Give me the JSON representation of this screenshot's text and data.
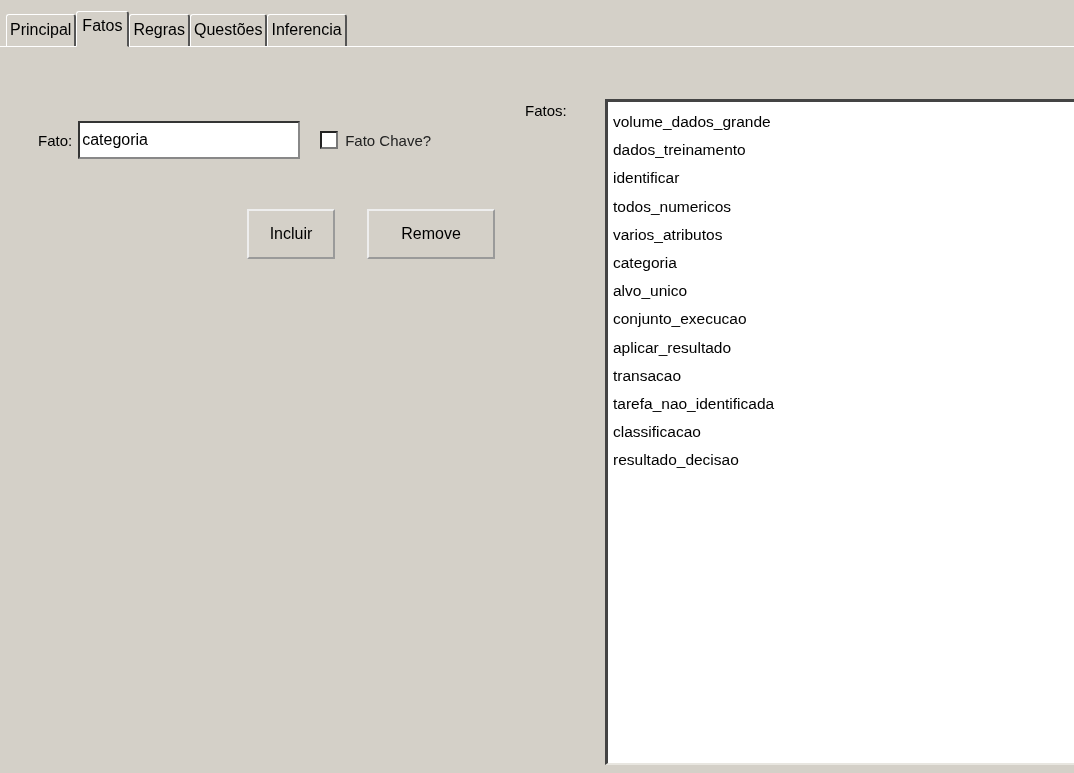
{
  "tabs": [
    {
      "label": "Principal",
      "selected": false
    },
    {
      "label": "Fatos",
      "selected": true
    },
    {
      "label": "Regras",
      "selected": false
    },
    {
      "label": "Questões",
      "selected": false
    },
    {
      "label": "Inferencia",
      "selected": false
    }
  ],
  "fact_field": {
    "label": "Fato:",
    "value": "categoria"
  },
  "key_fact": {
    "label": "Fato Chave?",
    "checked": false
  },
  "buttons": [
    "Incluir",
    "Remove"
  ],
  "facts_list": {
    "label": "Fatos:",
    "items": [
      "volume_dados_grande",
      "dados_treinamento",
      "identificar",
      "todos_numericos",
      "varios_atributos",
      "categoria",
      "alvo_unico",
      "conjunto_execucao",
      "aplicar_resultado",
      "transacao",
      "tarefa_nao_identificada",
      "classificacao",
      "resultado_decisao"
    ]
  }
}
